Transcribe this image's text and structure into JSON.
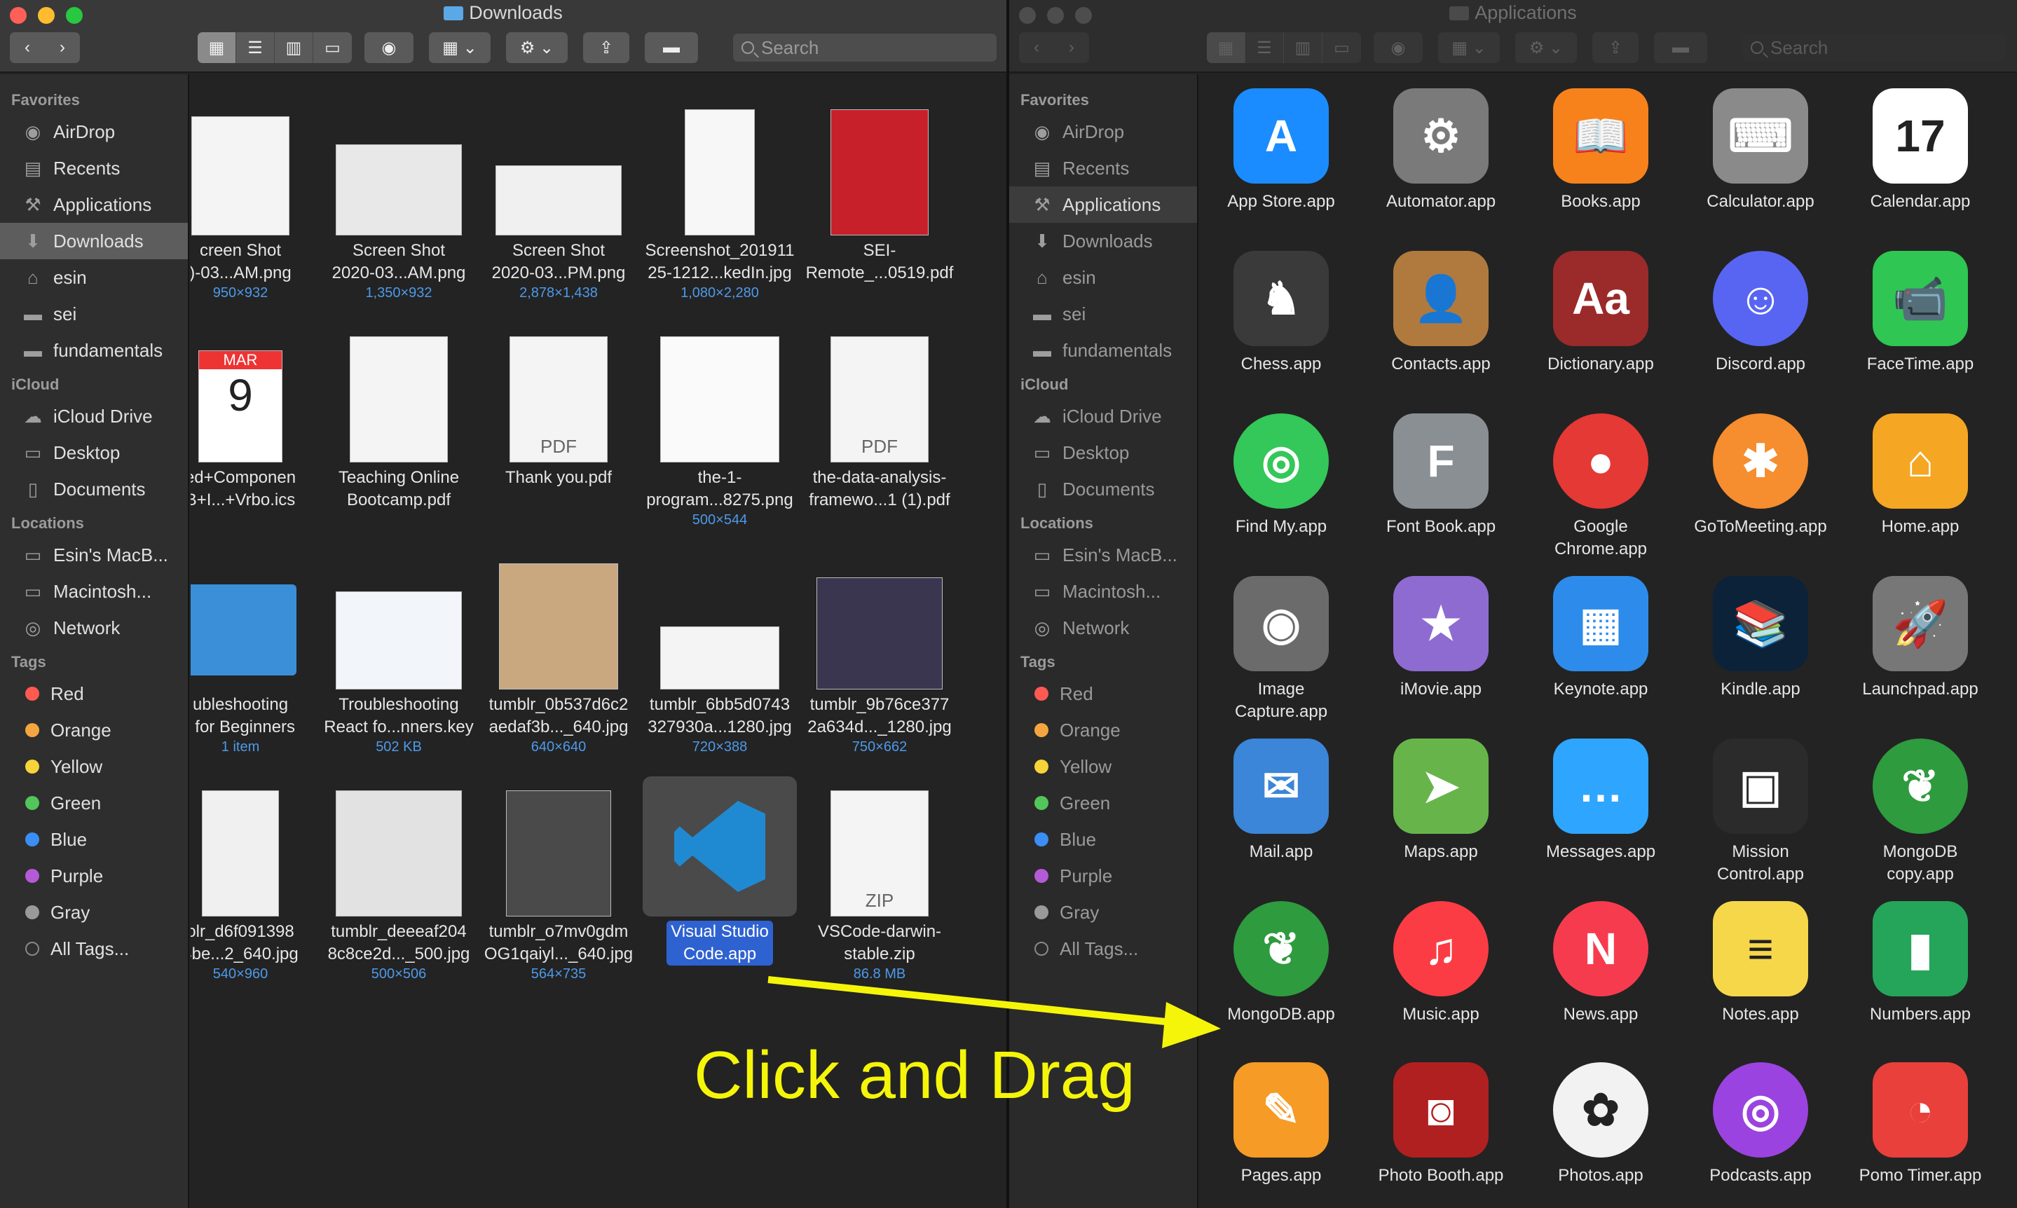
{
  "left_window": {
    "title": "Downloads",
    "search_placeholder": "Search",
    "sidebar": {
      "favorites_label": "Favorites",
      "favorites": [
        "AirDrop",
        "Recents",
        "Applications",
        "Downloads",
        "esin",
        "sei",
        "fundamentals"
      ],
      "icloud_label": "iCloud",
      "icloud": [
        "iCloud Drive",
        "Desktop",
        "Documents"
      ],
      "locations_label": "Locations",
      "locations": [
        "Esin's MacB...",
        "Macintosh...",
        "Network"
      ],
      "tags_label": "Tags",
      "tags": [
        "Red",
        "Orange",
        "Yellow",
        "Green",
        "Blue",
        "Purple",
        "Gray",
        "All Tags..."
      ]
    },
    "files": [
      {
        "name": "creen Shot\n)-03...AM.png",
        "meta": "950×932"
      },
      {
        "name": "Screen Shot\n2020-03...AM.png",
        "meta": "1,350×932"
      },
      {
        "name": "Screen Shot\n2020-03...PM.png",
        "meta": "2,878×1,438"
      },
      {
        "name": "Screenshot_201911\n25-1212...kedIn.jpg",
        "meta": "1,080×2,280"
      },
      {
        "name": "SEI-\nRemote_...0519.pdf",
        "meta": ""
      },
      {
        "name": "ed+Componen\nB+I...+Vrbo.ics",
        "meta": ""
      },
      {
        "name": "Teaching Online\nBootcamp.pdf",
        "meta": ""
      },
      {
        "name": "Thank you.pdf",
        "meta": ""
      },
      {
        "name": "the-1-\nprogram...8275.png",
        "meta": "500×544"
      },
      {
        "name": "the-data-analysis-\nframewo...1 (1).pdf",
        "meta": ""
      },
      {
        "name": "ubleshooting\nt for Beginners",
        "meta": "1 item"
      },
      {
        "name": "Troubleshooting\nReact fo...nners.key",
        "meta": "502 KB"
      },
      {
        "name": "tumblr_0b537d6c2\naedaf3b..._640.jpg",
        "meta": "640×640"
      },
      {
        "name": "tumblr_6bb5d0743\n327930a...1280.jpg",
        "meta": "720×388"
      },
      {
        "name": "tumblr_9b76ce377\n2a634d..._1280.jpg",
        "meta": "750×662"
      },
      {
        "name": "olr_d6f091398\n4be...2_640.jpg",
        "meta": "540×960"
      },
      {
        "name": "tumblr_deeeaf204\n8c8ce2d..._500.jpg",
        "meta": "500×506"
      },
      {
        "name": "tumblr_o7mv0gdm\nOG1qaiyl..._640.jpg",
        "meta": "564×735"
      },
      {
        "name": "Visual Studio\nCode.app",
        "meta": ""
      },
      {
        "name": "VSCode-darwin-\nstable.zip",
        "meta": "86.8 MB"
      }
    ],
    "thumb_texts": {
      "pdf": "PDF",
      "zip": "ZIP",
      "cal_month": "MAR",
      "cal_day": "9"
    }
  },
  "right_window": {
    "title": "Applications",
    "search_placeholder": "Search",
    "apps": [
      {
        "name": "App Store.app",
        "icon": "app-store-icon",
        "color": "#1a8cff",
        "glyph": "A"
      },
      {
        "name": "Automator.app",
        "icon": "automator-icon",
        "color": "#7a7a7a",
        "glyph": "⚙"
      },
      {
        "name": "Books.app",
        "icon": "books-icon",
        "color": "#f7821b",
        "glyph": "📖"
      },
      {
        "name": "Calculator.app",
        "icon": "calculator-icon",
        "color": "#8a8a8a",
        "glyph": "⌨"
      },
      {
        "name": "Calendar.app",
        "icon": "calendar-icon",
        "color": "#ffffff",
        "glyph": "17"
      },
      {
        "name": "Chess.app",
        "icon": "chess-icon",
        "color": "#3a3a3a",
        "glyph": "♞"
      },
      {
        "name": "Contacts.app",
        "icon": "contacts-icon",
        "color": "#b07a3e",
        "glyph": "👤"
      },
      {
        "name": "Dictionary.app",
        "icon": "dictionary-icon",
        "color": "#9b2a2a",
        "glyph": "Aa"
      },
      {
        "name": "Discord.app",
        "icon": "discord-icon",
        "color": "#5865f2",
        "glyph": "☺"
      },
      {
        "name": "FaceTime.app",
        "icon": "facetime-icon",
        "color": "#2fc653",
        "glyph": "📹"
      },
      {
        "name": "Find My.app",
        "icon": "find-my-icon",
        "color": "#34c759",
        "glyph": "◎"
      },
      {
        "name": "Font Book.app",
        "icon": "font-book-icon",
        "color": "#8a8f94",
        "glyph": "F"
      },
      {
        "name": "Google\nChrome.app",
        "icon": "chrome-icon",
        "color": "#e53935",
        "glyph": "●"
      },
      {
        "name": "GoToMeeting.app",
        "icon": "gotomeeting-icon",
        "color": "#f68d2e",
        "glyph": "✱"
      },
      {
        "name": "Home.app",
        "icon": "home-icon",
        "color": "#f5a623",
        "glyph": "⌂"
      },
      {
        "name": "Image\nCapture.app",
        "icon": "image-capture-icon",
        "color": "#6b6b6b",
        "glyph": "◉"
      },
      {
        "name": "iMovie.app",
        "icon": "imovie-icon",
        "color": "#8e6bd1",
        "glyph": "★"
      },
      {
        "name": "Keynote.app",
        "icon": "keynote-icon",
        "color": "#2d8ceb",
        "glyph": "▦"
      },
      {
        "name": "Kindle.app",
        "icon": "kindle-icon",
        "color": "#0b2239",
        "glyph": "📚"
      },
      {
        "name": "Launchpad.app",
        "icon": "launchpad-icon",
        "color": "#777777",
        "glyph": "🚀"
      },
      {
        "name": "Mail.app",
        "icon": "mail-icon",
        "color": "#3b86d8",
        "glyph": "✉"
      },
      {
        "name": "Maps.app",
        "icon": "maps-icon",
        "color": "#67b54a",
        "glyph": "➤"
      },
      {
        "name": "Messages.app",
        "icon": "messages-icon",
        "color": "#2ea6ff",
        "glyph": "…"
      },
      {
        "name": "Mission\nControl.app",
        "icon": "mission-control-icon",
        "color": "#2b2b2b",
        "glyph": "▣"
      },
      {
        "name": "MongoDB\ncopy.app",
        "icon": "mongodb-copy-icon",
        "color": "#2e9b3f",
        "glyph": "❦"
      },
      {
        "name": "MongoDB.app",
        "icon": "mongodb-icon",
        "color": "#2e9b3f",
        "glyph": "❦"
      },
      {
        "name": "Music.app",
        "icon": "music-icon",
        "color": "#fc3c44",
        "glyph": "♫"
      },
      {
        "name": "News.app",
        "icon": "news-icon",
        "color": "#f73b4f",
        "glyph": "N"
      },
      {
        "name": "Notes.app",
        "icon": "notes-icon",
        "color": "#f7d74a",
        "glyph": "≡"
      },
      {
        "name": "Numbers.app",
        "icon": "numbers-icon",
        "color": "#25a55a",
        "glyph": "▮"
      },
      {
        "name": "Pages.app",
        "icon": "pages-icon",
        "color": "#f59b26",
        "glyph": "✎"
      },
      {
        "name": "Photo Booth.app",
        "icon": "photo-booth-icon",
        "color": "#b02020",
        "glyph": "◙"
      },
      {
        "name": "Photos.app",
        "icon": "photos-icon",
        "color": "#f2f2f2",
        "glyph": "✿"
      },
      {
        "name": "Podcasts.app",
        "icon": "podcasts-icon",
        "color": "#9b43e0",
        "glyph": "◎"
      },
      {
        "name": "Pomo Timer.app",
        "icon": "pomo-timer-icon",
        "color": "#e9403b",
        "glyph": "◔"
      }
    ]
  },
  "annotation": {
    "text": "Click and Drag",
    "color": "#f5f50a"
  },
  "colors": {
    "tag_red": "#ff5a52",
    "tag_orange": "#f5a540",
    "tag_yellow": "#f6d43a",
    "tag_green": "#52c65a",
    "tag_blue": "#3a8ef6",
    "tag_purple": "#b45ad6",
    "tag_gray": "#9a9a9a",
    "selection": "#2f62d1"
  }
}
